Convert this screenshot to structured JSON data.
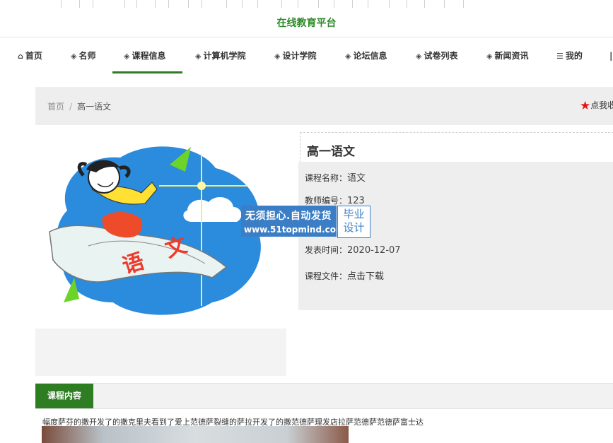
{
  "header": {
    "site_title": "在线教育平台"
  },
  "nav": {
    "items": [
      {
        "label": "首页",
        "icon": "home-icon"
      },
      {
        "label": "名师",
        "icon": "layers-icon"
      },
      {
        "label": "课程信息",
        "icon": "layers-icon",
        "active": true
      },
      {
        "label": "计算机学院",
        "icon": "layers-icon"
      },
      {
        "label": "设计学院",
        "icon": "layers-icon"
      },
      {
        "label": "论坛信息",
        "icon": "layers-icon"
      },
      {
        "label": "试卷列表",
        "icon": "layers-icon"
      },
      {
        "label": "新闻资讯",
        "icon": "layers-icon"
      },
      {
        "label": "我的",
        "icon": "list-icon"
      }
    ]
  },
  "breadcrumb": {
    "home": "首页",
    "separator": "/",
    "current": "高一语文",
    "favorite_label": "点我收"
  },
  "course": {
    "title": "高一语文",
    "fields": [
      {
        "key": "课程名称：",
        "value": "语文"
      },
      {
        "key": "教师编号：",
        "value": "123"
      },
      {
        "key": "发表时间：",
        "value": "2020-12-07"
      },
      {
        "key": "课程文件：",
        "value": "点击下载"
      }
    ]
  },
  "watermark": {
    "line1": "无须担心.自动发货",
    "line2": "www.51topmind.com",
    "badge1": "毕业",
    "badge2": "设计"
  },
  "content": {
    "tab_label": "课程内容",
    "text": "幅度萨芬的撒开发了的撒克里夫看到了爱上范德萨裂缝的萨拉开发了的撒范德萨理发店拉萨范德萨范德萨富士达"
  },
  "colors": {
    "accent": "#2e7d22",
    "title_green": "#2f8a2a",
    "watermark_blue": "#3b7ec5",
    "star_red": "#ee1111"
  }
}
